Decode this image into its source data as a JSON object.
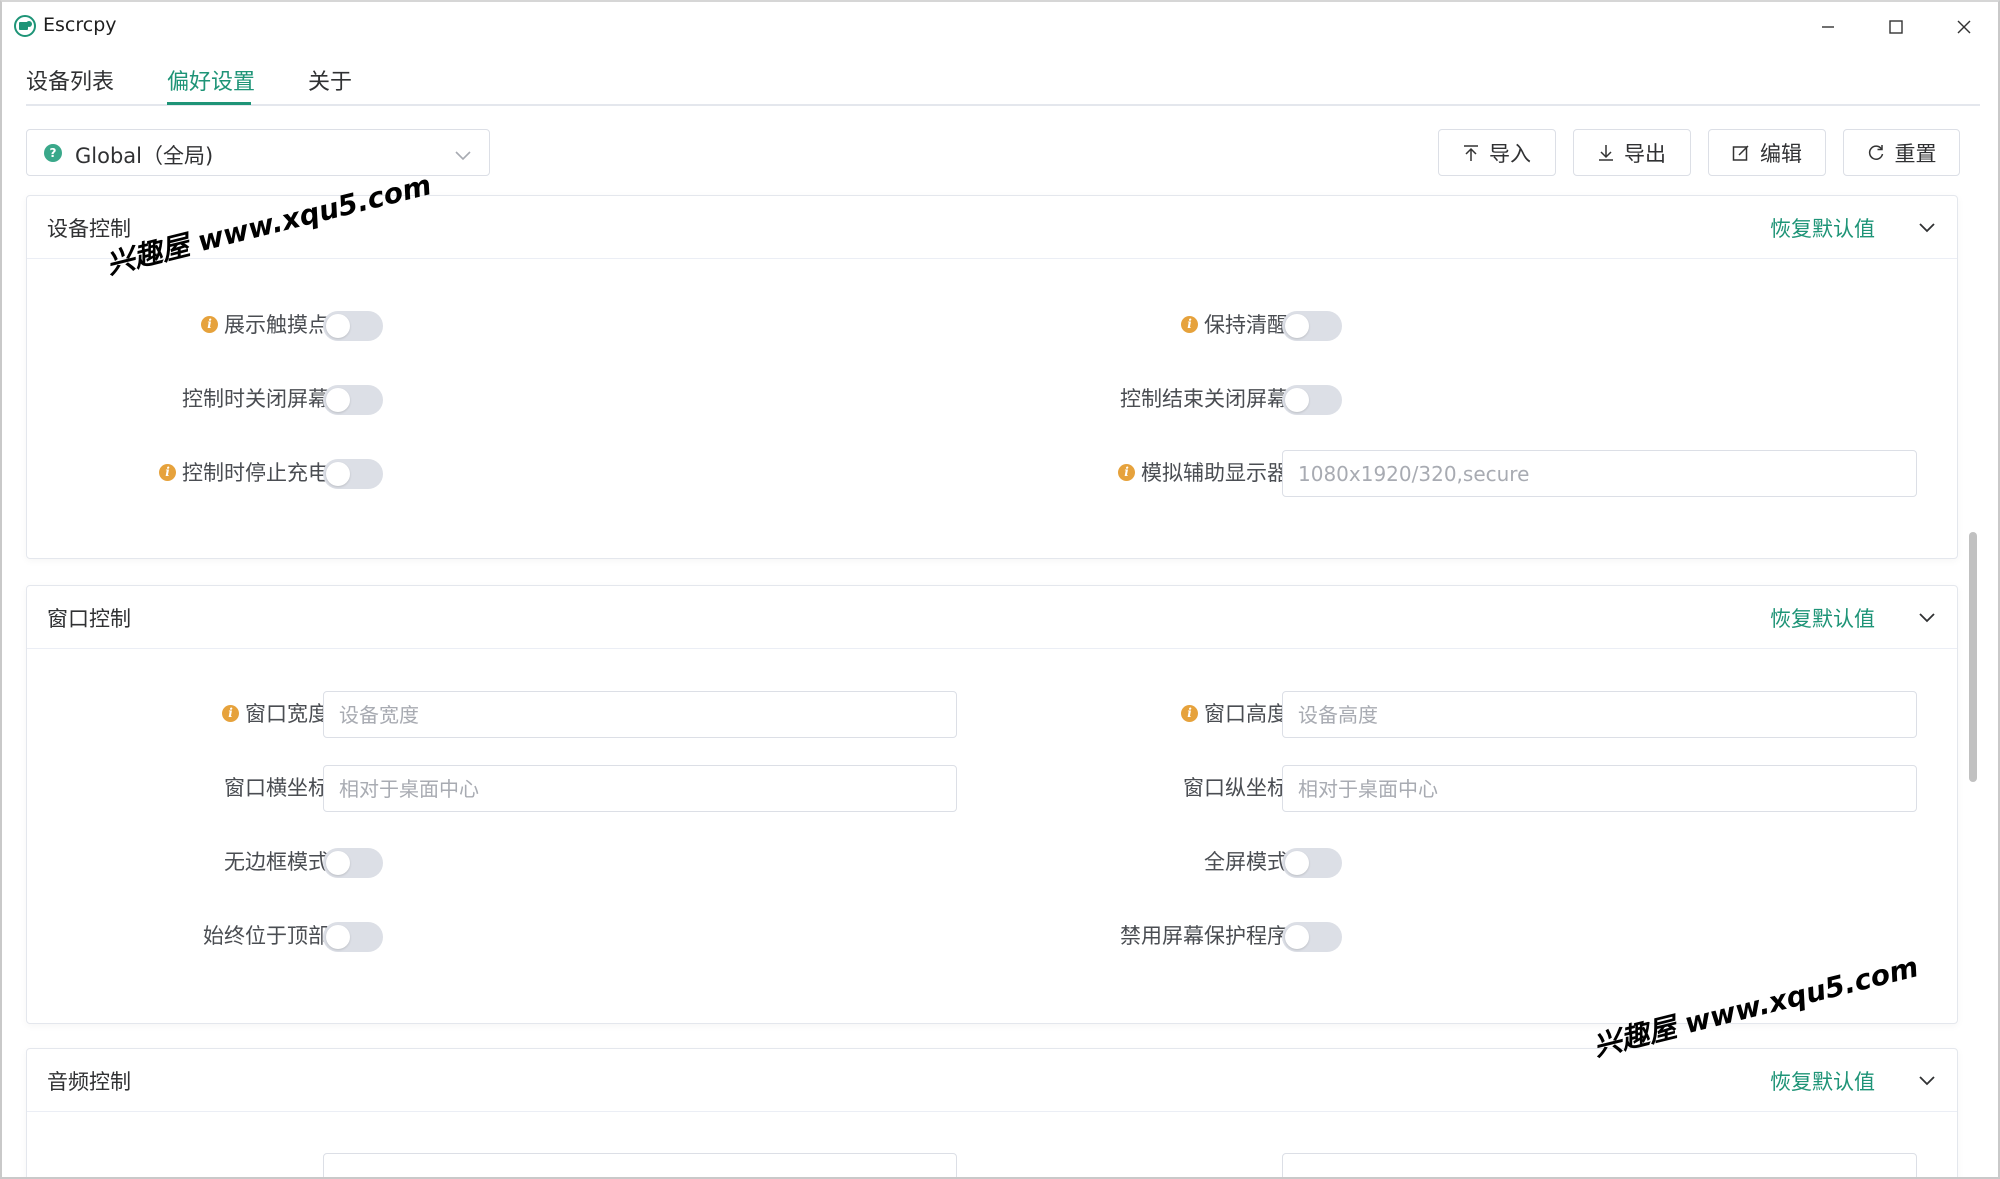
{
  "app": {
    "title": "Escrcpy"
  },
  "tabs": [
    {
      "label": "设备列表",
      "active": false
    },
    {
      "label": "偏好设置",
      "active": true
    },
    {
      "label": "关于",
      "active": false
    }
  ],
  "toolbar": {
    "scope_value": "Global（全局)",
    "import_label": "导入",
    "export_label": "导出",
    "edit_label": "编辑",
    "reset_label": "重置"
  },
  "sections": {
    "device_control": {
      "title": "设备控制",
      "reset": "恢复默认值",
      "show_touches": {
        "label": "展示触摸点",
        "on": false
      },
      "stay_awake": {
        "label": "保持清醒",
        "on": false
      },
      "turn_screen_off": {
        "label": "控制时关闭屏幕",
        "on": false
      },
      "power_off_on_close": {
        "label": "控制结束关闭屏幕",
        "on": false
      },
      "stop_charging": {
        "label": "控制时停止充电",
        "on": false
      },
      "virtual_display": {
        "label": "模拟辅助显示器",
        "placeholder": "1080x1920/320,secure"
      }
    },
    "window_control": {
      "title": "窗口控制",
      "reset": "恢复默认值",
      "window_width": {
        "label": "窗口宽度",
        "placeholder": "设备宽度"
      },
      "window_height": {
        "label": "窗口高度",
        "placeholder": "设备高度"
      },
      "window_x": {
        "label": "窗口横坐标",
        "placeholder": "相对于桌面中心"
      },
      "window_y": {
        "label": "窗口纵坐标",
        "placeholder": "相对于桌面中心"
      },
      "borderless": {
        "label": "无边框模式",
        "on": false
      },
      "fullscreen": {
        "label": "全屏模式",
        "on": false
      },
      "always_on_top": {
        "label": "始终位于顶部",
        "on": false
      },
      "disable_screensaver": {
        "label": "禁用屏幕保护程序",
        "on": false
      }
    },
    "audio_control": {
      "title": "音频控制",
      "reset": "恢复默认值"
    }
  },
  "watermarks": [
    "兴趣屋 www.xqu5.com",
    "兴趣屋 www.xqu5.com"
  ],
  "colors": {
    "accent": "#1e9477",
    "info": "#e6a23c",
    "border": "#dcdfe6"
  }
}
